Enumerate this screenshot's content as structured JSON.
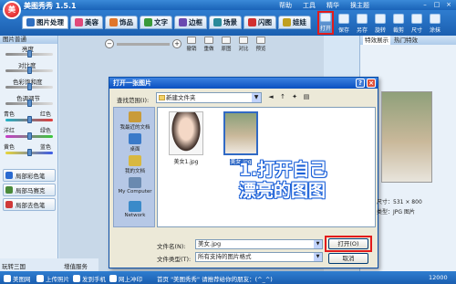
{
  "titlebar": {
    "logo_text": "美",
    "title": "美图秀秀 1.5.1",
    "menu": [
      "帮助",
      "工具",
      "精华",
      "换主题"
    ],
    "minimize": "–",
    "maximize": "□",
    "close": "×"
  },
  "tabs": [
    {
      "label": "图片处理",
      "color": "#2f6fc0"
    },
    {
      "label": "美容",
      "color": "#e04a7a"
    },
    {
      "label": "饰品",
      "color": "#e0762a"
    },
    {
      "label": "文字",
      "color": "#3a9a3a"
    },
    {
      "label": "边框",
      "color": "#6a4ab0"
    },
    {
      "label": "场景",
      "color": "#2a8a9a"
    },
    {
      "label": "闪图",
      "color": "#d03030"
    },
    {
      "label": "娃娃",
      "color": "#c0a020"
    }
  ],
  "toolbar": [
    "打开",
    "保存",
    "另存",
    "旋转",
    "裁剪",
    "尺寸",
    "涂抹"
  ],
  "left_panel": {
    "title": "图片普通",
    "sliders": [
      {
        "label": "亮度",
        "level": 0.5
      },
      {
        "label": "对比度",
        "level": 0.5
      },
      {
        "label": "色彩饱和度",
        "level": 0.5
      },
      {
        "label": "色调调节",
        "level": 0.5
      }
    ],
    "color_pairs": [
      {
        "left": "青色",
        "right": "红色",
        "level": 0.5
      },
      {
        "left": "洋红",
        "right": "绿色",
        "level": 0.5
      },
      {
        "left": "黄色",
        "right": "蓝色",
        "level": 0.5
      }
    ],
    "buttons": [
      {
        "label": "局部彩色笔",
        "color": "#2a6ad0"
      },
      {
        "label": "局部马赛克",
        "color": "#4a8a3a"
      },
      {
        "label": "局部去色笔",
        "color": "#d03a3a"
      }
    ],
    "bottom_tabs": [
      "玩转三国",
      "增值服务"
    ]
  },
  "canvas_tools": {
    "zoom_out": "−",
    "zoom_in": "+",
    "buttons": [
      "撤销",
      "重做",
      "原图",
      "对比",
      "预览"
    ]
  },
  "right_panel": {
    "tabs": [
      "特效展示",
      "热门特效"
    ]
  },
  "dialog": {
    "title": "打开一张图片",
    "help": "?",
    "close": "×",
    "look_in_label": "查找范围(I):",
    "look_in_value": "新建文件夹",
    "places": [
      {
        "label": "我最近的文档",
        "color": "#c99b3a"
      },
      {
        "label": "桌面",
        "color": "#3a7ac9"
      },
      {
        "label": "我的文档",
        "color": "#d8b840"
      },
      {
        "label": "My Computer",
        "color": "#6a8ab0"
      },
      {
        "label": "Network",
        "color": "#3a8ac9"
      }
    ],
    "files": [
      {
        "name": "美女1.jpg",
        "selected": false
      },
      {
        "name": "美女.jpg",
        "selected": true
      }
    ],
    "file_name_label": "文件名(N):",
    "file_name_value": "美女.jpg",
    "file_type_label": "文件类型(T):",
    "file_type_value": "所有支持的图片格式",
    "open_button": "打开(O)",
    "cancel_button": "取消"
  },
  "annotation": {
    "line1": "1.打开自己",
    "line2": "漂亮的图图"
  },
  "preview": {
    "size_label": "尺寸：",
    "size_value": "531 × 800",
    "type_label": "类型：",
    "type_value": "JPG 图片"
  },
  "statusbar": {
    "items": [
      "美图网",
      "上传照片",
      "发到手机",
      "网上冲印"
    ],
    "message": "首页 \"美图秀秀\" 请推荐给你的朋友：(^_^)",
    "counter": "12000"
  }
}
